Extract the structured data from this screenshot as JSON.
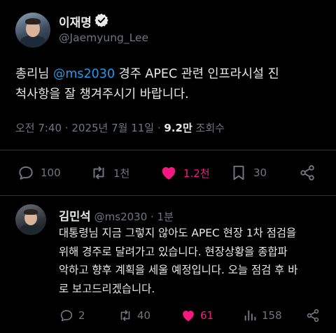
{
  "main_post": {
    "author_name": "이재명",
    "author_handle": "@Jaemyung_Lee",
    "text_prefix": "총리님 ",
    "mention": "@ms2030",
    "text_line1_suffix": " 경주 APEC 관련 인프라시설 진",
    "text_line2": "척사항을 잘 챙겨주시기 바랍니다.",
    "timestamp": "오전 7:40 · 2025년 7월 11일 · ",
    "views_count": "9.2만",
    "views_label": " 조회수",
    "stats": {
      "replies": "100",
      "reposts": "1천",
      "likes": "1.2천",
      "bookmarks": "30"
    }
  },
  "reply_post": {
    "author_name": "김민석",
    "author_handle": "@ms2030 · 1분",
    "text_line1": "대통령님 지금 그렇지 않아도 APEC 현장 1차 점검을",
    "text_line2": "위해 경주로 달려가고 있습니다. 현장상황을 종합파",
    "text_line3": "악하고 향후 계획을 세울 예정입니다. 오늘 점검 후 바",
    "text_line4": "로 보고드리겠습니다.",
    "stats": {
      "replies": "2",
      "reposts": "40",
      "likes": "61",
      "views": "158"
    }
  },
  "colors": {
    "background": "#000000",
    "text": "#e7e9ea",
    "muted": "#71767b",
    "accent": "#1d9bf0",
    "like": "#f91880",
    "divider": "#2f3336"
  },
  "icons": [
    "verified-badge-icon",
    "reply-icon",
    "repost-icon",
    "like-icon",
    "bookmark-icon",
    "share-icon",
    "views-icon"
  ]
}
